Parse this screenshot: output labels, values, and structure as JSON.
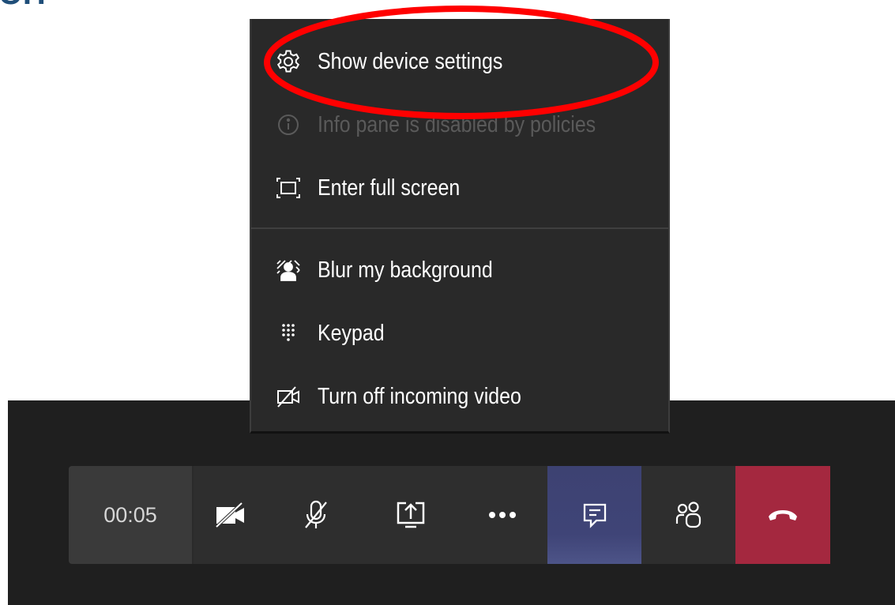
{
  "menu": {
    "items": [
      {
        "label": "Show device settings",
        "icon": "gear-icon"
      },
      {
        "label": "Info pane is disabled by policies",
        "icon": "info-icon",
        "disabled": true
      },
      {
        "label": "Enter full screen",
        "icon": "fullscreen-icon"
      },
      {
        "label": "Blur my background",
        "icon": "blur-background-icon"
      },
      {
        "label": "Keypad",
        "icon": "keypad-icon"
      },
      {
        "label": "Turn off incoming video",
        "icon": "incoming-video-off-icon"
      }
    ]
  },
  "toolbar": {
    "timer": "00:05",
    "buttons": [
      {
        "icon": "camera-off-icon"
      },
      {
        "icon": "mic-off-icon"
      },
      {
        "icon": "share-screen-icon"
      },
      {
        "icon": "more-options-icon"
      },
      {
        "icon": "chat-icon",
        "active": true
      },
      {
        "icon": "participants-icon"
      },
      {
        "icon": "hang-up-icon"
      }
    ]
  },
  "colors": {
    "menu_background": "#292929",
    "toolbar_background": "#2e2e2e",
    "timer_background": "#3a3a3a",
    "active_button": "#3f4477",
    "hang_up": "#a4283f",
    "highlight_ring": "#ff0000",
    "disabled_text": "#5a5a5a"
  }
}
